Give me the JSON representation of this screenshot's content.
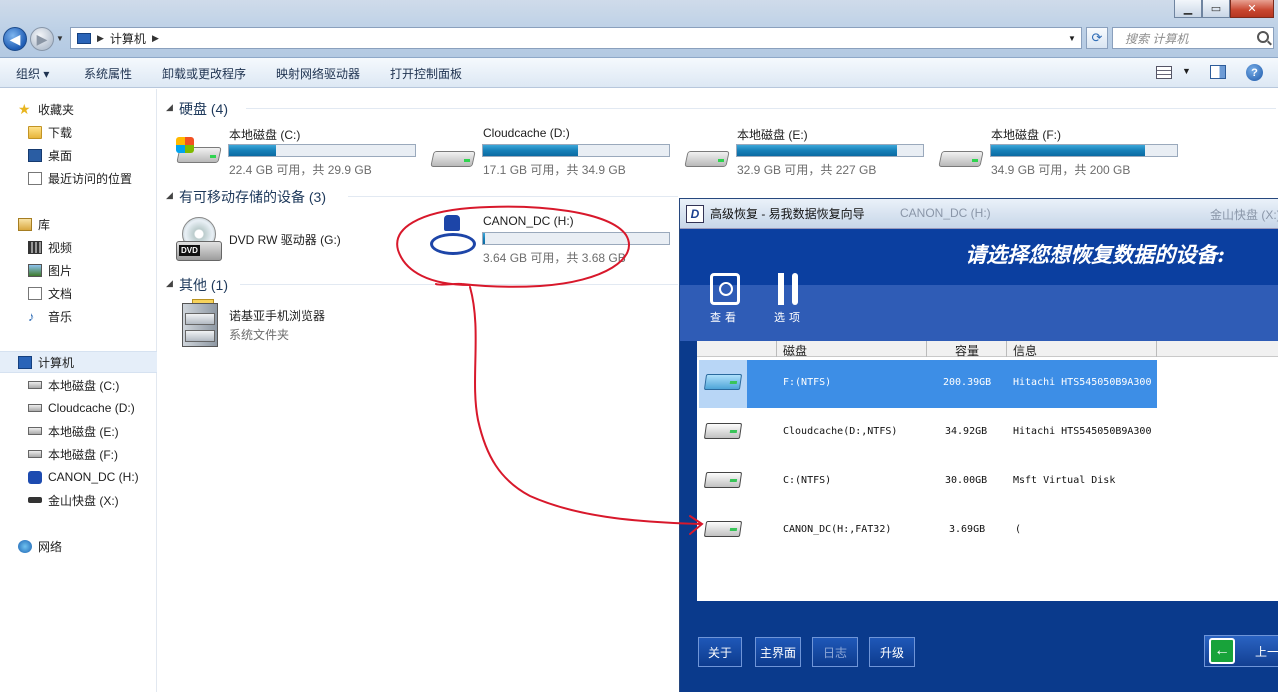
{
  "window": {
    "minimize": "▁",
    "maximize": "▭",
    "close": "✕"
  },
  "address": {
    "crumb": "计算机",
    "search_placeholder": "搜索 计算机"
  },
  "commands": [
    "组织",
    "系统属性",
    "卸载或更改程序",
    "映射网络驱动器",
    "打开控制面板"
  ],
  "sidebar": {
    "favorites": "收藏夹",
    "downloads": "下载",
    "desktop": "桌面",
    "recent": "最近访问的位置",
    "libraries": "库",
    "videos": "视频",
    "pictures": "图片",
    "documents": "文档",
    "music": "音乐",
    "computer": "计算机",
    "drives": [
      "本地磁盘 (C:)",
      "Cloudcache (D:)",
      "本地磁盘 (E:)",
      "本地磁盘 (F:)",
      "CANON_DC (H:)",
      "金山快盘 (X:)"
    ],
    "network": "网络"
  },
  "content": {
    "hdd_group": "硬盘 (4)",
    "hdds": [
      {
        "name": "本地磁盘 (C:)",
        "info": "22.4 GB 可用，共 29.9 GB",
        "used_fraction": 0.25
      },
      {
        "name": "Cloudcache (D:)",
        "info": "17.1 GB 可用，共 34.9 GB",
        "used_fraction": 0.51
      },
      {
        "name": "本地磁盘 (E:)",
        "info": "32.9 GB 可用，共 227 GB",
        "used_fraction": 0.86
      },
      {
        "name": "本地磁盘 (F:)",
        "info": "34.9 GB 可用，共 200 GB",
        "used_fraction": 0.83
      }
    ],
    "removable_group": "有可移动存储的设备 (3)",
    "dvd": {
      "name": "DVD RW 驱动器 (G:)",
      "badge": "DVD"
    },
    "canon": {
      "name": "CANON_DC (H:)",
      "info": "3.64 GB 可用，共 3.68 GB",
      "used_fraction": 0.01
    },
    "other_group": "其他 (1)",
    "nokia": {
      "name": "诺基亚手机浏览器",
      "sub": "系统文件夹"
    }
  },
  "app": {
    "title": "高级恢复 - 易我数据恢复向导",
    "logo": "D",
    "ghost_title": "CANON_DC (H:)",
    "ghost_title2": "金山快盘 (X:)",
    "heading": "请选择您想恢复数据的设备:",
    "tools": [
      {
        "label": "查看",
        "icon": "magnifier-icon"
      },
      {
        "label": "选项",
        "icon": "tools-icon"
      }
    ],
    "columns": [
      "磁盘",
      "容量",
      "信息"
    ],
    "disks": [
      {
        "name": "F:(NTFS)",
        "size": "200.39GB",
        "info": "Hitachi HTS545050B9A300",
        "selected": true
      },
      {
        "name": "Cloudcache(D:,NTFS)",
        "size": "34.92GB",
        "info": "Hitachi HTS545050B9A300",
        "selected": false
      },
      {
        "name": "C:(NTFS)",
        "size": "30.00GB",
        "info": "Msft Virtual Disk",
        "selected": false
      },
      {
        "name": "CANON_DC(H:,FAT32)",
        "size": "3.69GB",
        "info": "(",
        "selected": false
      }
    ],
    "buttons": {
      "about": "关于",
      "main": "主界面",
      "log": "日志",
      "upgrade": "升级",
      "back": "上一"
    }
  },
  "colors": {
    "accent": "#0b3fa0",
    "annotation": "#d8182b",
    "bar_fill": "#1680b8"
  }
}
